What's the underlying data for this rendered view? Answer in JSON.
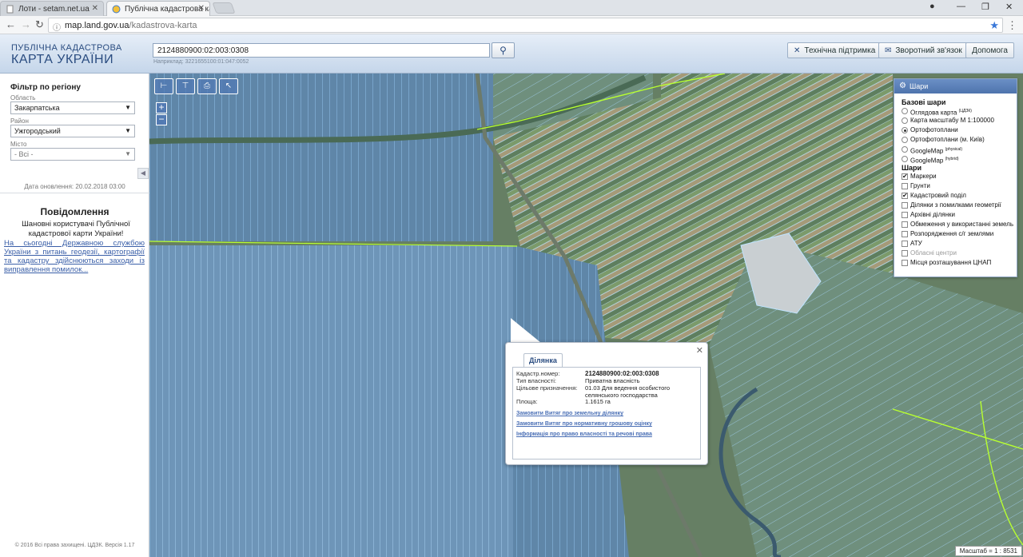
{
  "browser": {
    "tabs": [
      {
        "label": "Лоти - setam.net.ua",
        "active": false
      },
      {
        "label": "Публічна кадастрова ка",
        "active": true
      }
    ],
    "url_domain": "map.land.gov.ua",
    "url_path": "/kadastrova-karta"
  },
  "header": {
    "logo_line1": "ПУБЛІЧНА КАДАСТРОВА",
    "logo_line2": "КАРТА УКРАЇНИ",
    "search_value": "2124880900:02:003:0308",
    "search_hint": "Наприклад: 3221655100:01:047:0052",
    "buttons": {
      "support": "Технічна підтримка",
      "feedback": "Зворотний зв'язок",
      "help": "Допомога"
    }
  },
  "filter": {
    "title": "Фільтр по регіону",
    "oblast_label": "Область",
    "oblast_value": "Закарпатська",
    "raion_label": "Район",
    "raion_value": "Ужгородський",
    "misto_label": "Місто",
    "misto_value": "- Всі -"
  },
  "updated": "Дата оновлення: 20.02.2018 03:00",
  "notices": {
    "title": "Повідомлення",
    "text": "Шановні користувачі Публічної кадастрової карти України!",
    "link": "На сьогодні Державною службою України з питань геодезії, картографії та кадастру здійснюються заходи із виправлення помилок..."
  },
  "copyright": "© 2016 Всі права захищені. ЦДЗК. Версія 1.17",
  "layers": {
    "title": "Шари",
    "base_title": "Базові шари",
    "base": [
      {
        "label": "Оглядова карта",
        "sup": "(ЦДЗК)",
        "checked": false
      },
      {
        "label": "Карта масштабу М 1:100000",
        "sup": "",
        "checked": false
      },
      {
        "label": "Ортофотоплани",
        "sup": "",
        "checked": true
      },
      {
        "label": "Ортофотоплани (м. Київ)",
        "sup": "",
        "checked": false
      },
      {
        "label": "GoogleMap",
        "sup": "(physical)",
        "checked": false
      },
      {
        "label": "GoogleMap",
        "sup": "(hybrid)",
        "checked": false
      }
    ],
    "overlay_title": "Шари",
    "overlays": [
      {
        "label": "Маркери",
        "checked": true,
        "disabled": false
      },
      {
        "label": "Грунти",
        "checked": false,
        "disabled": false
      },
      {
        "label": "Кадастровий поділ",
        "checked": true,
        "disabled": false
      },
      {
        "label": "Ділянки з помилками геометрії",
        "checked": false,
        "disabled": false
      },
      {
        "label": "Архівні ділянки",
        "checked": false,
        "disabled": false
      },
      {
        "label": "Обмеження у використанні земель",
        "checked": false,
        "disabled": false
      },
      {
        "label": "Розпорядження с/г землями",
        "checked": false,
        "disabled": false
      },
      {
        "label": "АТУ",
        "checked": false,
        "disabled": false
      },
      {
        "label": "Обласні центри",
        "checked": false,
        "disabled": true
      },
      {
        "label": "Місця розташування ЦНАП",
        "checked": false,
        "disabled": false
      }
    ]
  },
  "popup": {
    "tab": "Ділянка",
    "fields": [
      {
        "key": "Кадастр.номер:",
        "value": "2124880900:02:003:0308",
        "bold": true
      },
      {
        "key": "Тип власності:",
        "value": "Приватна власність",
        "bold": false
      },
      {
        "key": "Цільове призначення:",
        "value": "01.03 Для ведення особистого селянського господарства",
        "bold": false
      },
      {
        "key": "Площа:",
        "value": "1.1615 га",
        "bold": false
      }
    ],
    "links": [
      "Замовити Витяг про земельну ділянку",
      "Замовити Витяг про нормативну грошову оцінку",
      "Інформація про право власності та речові права"
    ]
  },
  "scale": "Масштаб = 1 : 8531",
  "colors": {
    "header_text": "#2a4c80",
    "map_green": "#6f8c6f",
    "parcel_outline": "#9fd3ff",
    "boundary": "#b8ff30"
  }
}
